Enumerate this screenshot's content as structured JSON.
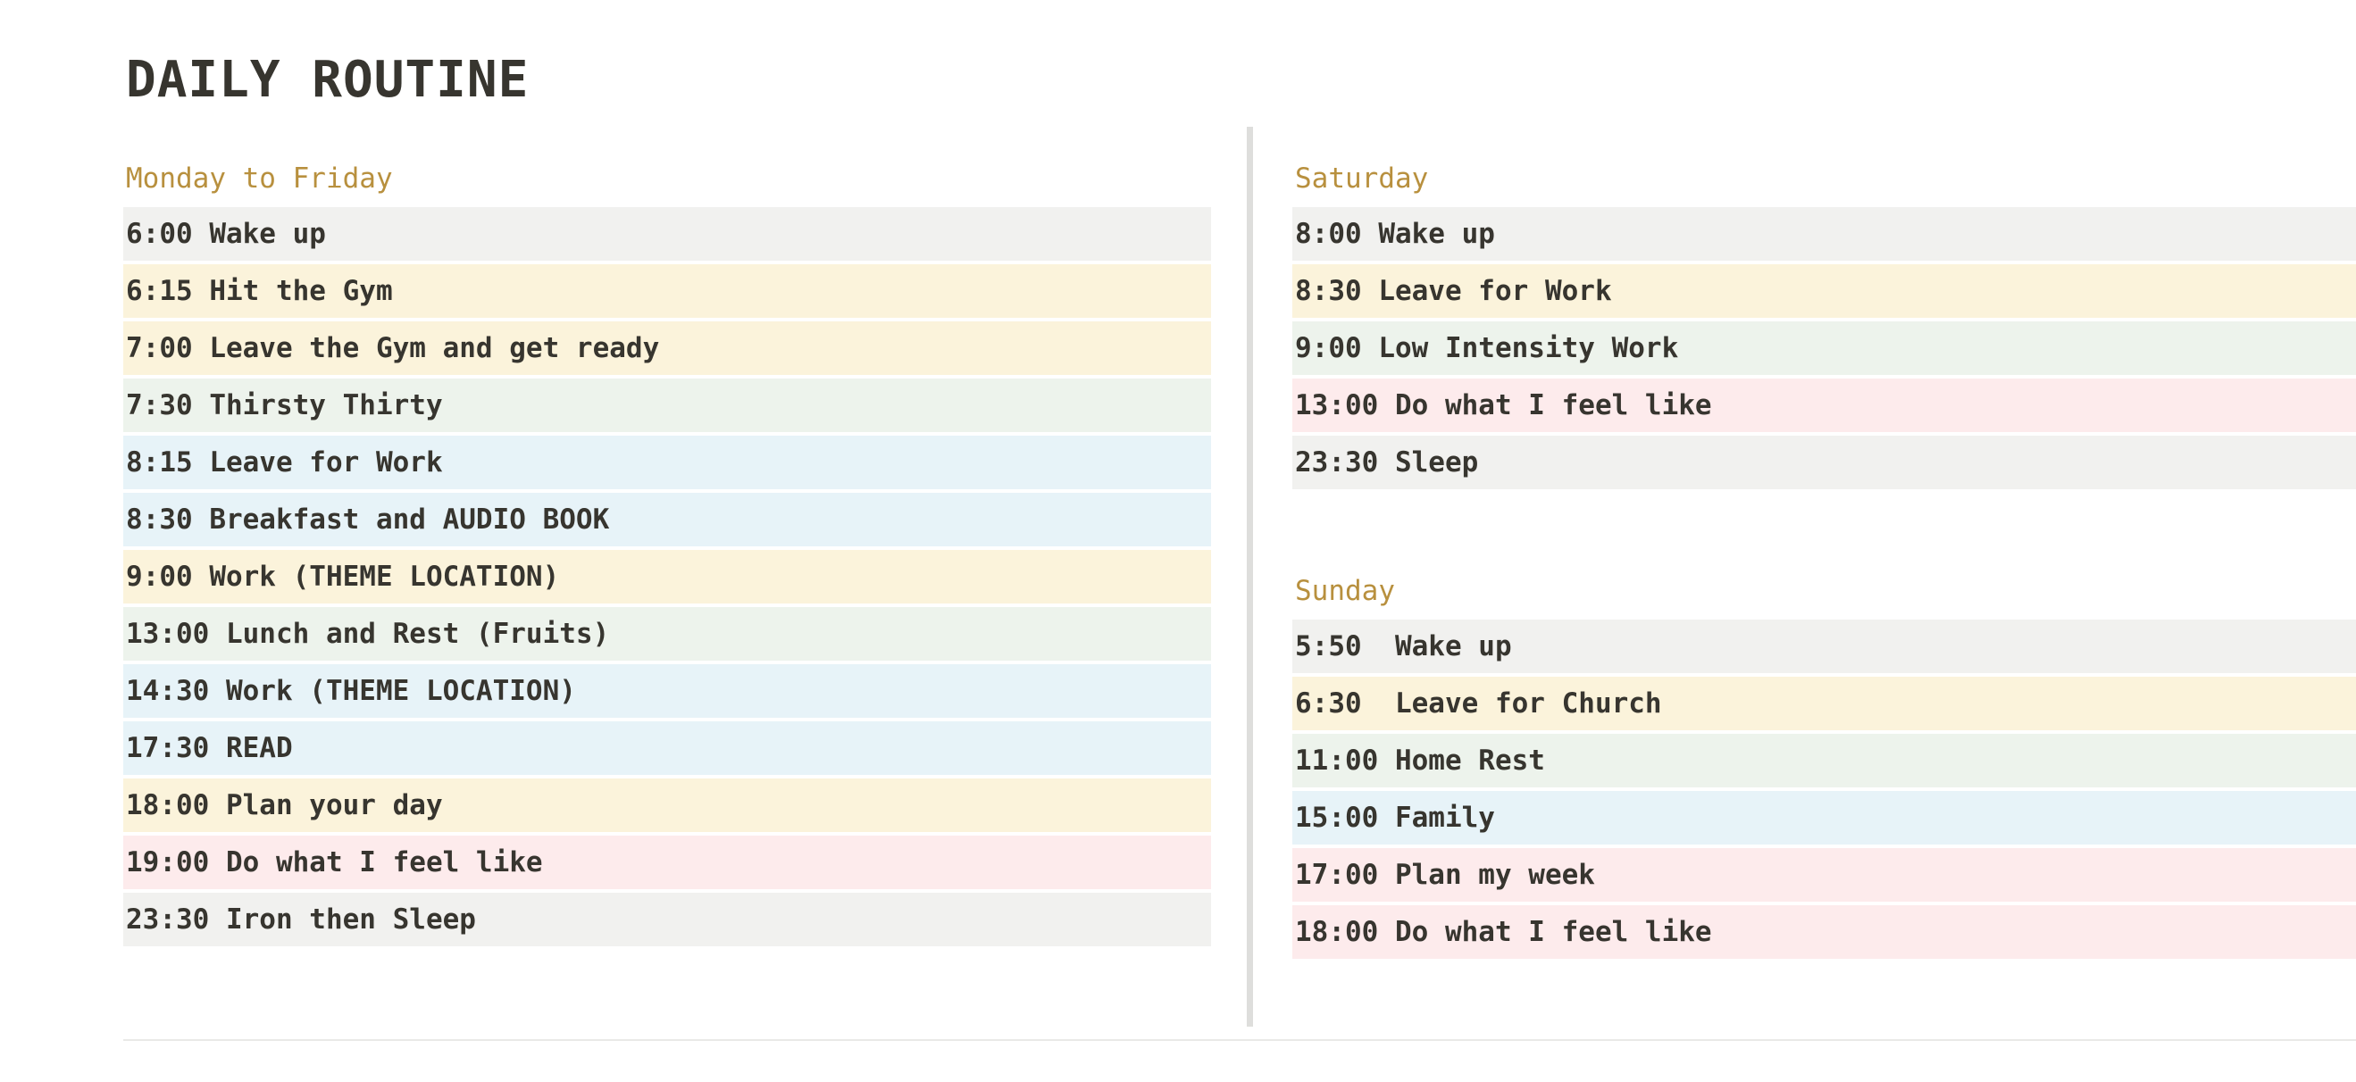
{
  "page": {
    "title": "DAILY ROUTINE"
  },
  "colors": {
    "heading": "#b8903e",
    "text": "#37352f",
    "gray": "#f1f1ef",
    "yellow": "#fbf3db",
    "green": "#edf3ec",
    "blue": "#e7f3f8",
    "red": "#fdebec",
    "divider": "#dededc"
  },
  "weekday": {
    "heading": "Monday to Friday",
    "items": [
      {
        "text": "6:00 Wake up",
        "color": "gray"
      },
      {
        "text": "6:15 Hit the Gym",
        "color": "yellow"
      },
      {
        "text": "7:00 Leave the Gym and get ready",
        "color": "yellow"
      },
      {
        "text": "7:30 Thirsty Thirty",
        "color": "green"
      },
      {
        "text": "8:15 Leave for Work",
        "color": "blue"
      },
      {
        "text": "8:30 Breakfast and AUDIO BOOK",
        "color": "blue"
      },
      {
        "text": "9:00 Work (THEME LOCATION)",
        "color": "yellow"
      },
      {
        "text": "13:00 Lunch and Rest (Fruits)",
        "color": "green"
      },
      {
        "text": "14:30 Work (THEME LOCATION)",
        "color": "blue"
      },
      {
        "text": "17:30 READ",
        "color": "blue"
      },
      {
        "text": "18:00 Plan your day",
        "color": "yellow"
      },
      {
        "text": "19:00 Do what I feel like",
        "color": "red"
      },
      {
        "text": "23:30 Iron then Sleep",
        "color": "gray"
      }
    ]
  },
  "saturday": {
    "heading": "Saturday",
    "items": [
      {
        "text": "8:00 Wake up",
        "color": "gray"
      },
      {
        "text": "8:30 Leave for Work",
        "color": "yellow"
      },
      {
        "text": "9:00 Low Intensity Work",
        "color": "green"
      },
      {
        "text": "13:00 Do what I feel like",
        "color": "red"
      },
      {
        "text": "23:30 Sleep",
        "color": "gray"
      }
    ]
  },
  "sunday": {
    "heading": "Sunday",
    "items": [
      {
        "text": "5:50  Wake up",
        "color": "gray"
      },
      {
        "text": "6:30  Leave for Church",
        "color": "yellow"
      },
      {
        "text": "11:00 Home Rest",
        "color": "green"
      },
      {
        "text": "15:00 Family",
        "color": "blue"
      },
      {
        "text": "17:00 Plan my week",
        "color": "red"
      },
      {
        "text": "18:00 Do what I feel like",
        "color": "red"
      }
    ]
  }
}
